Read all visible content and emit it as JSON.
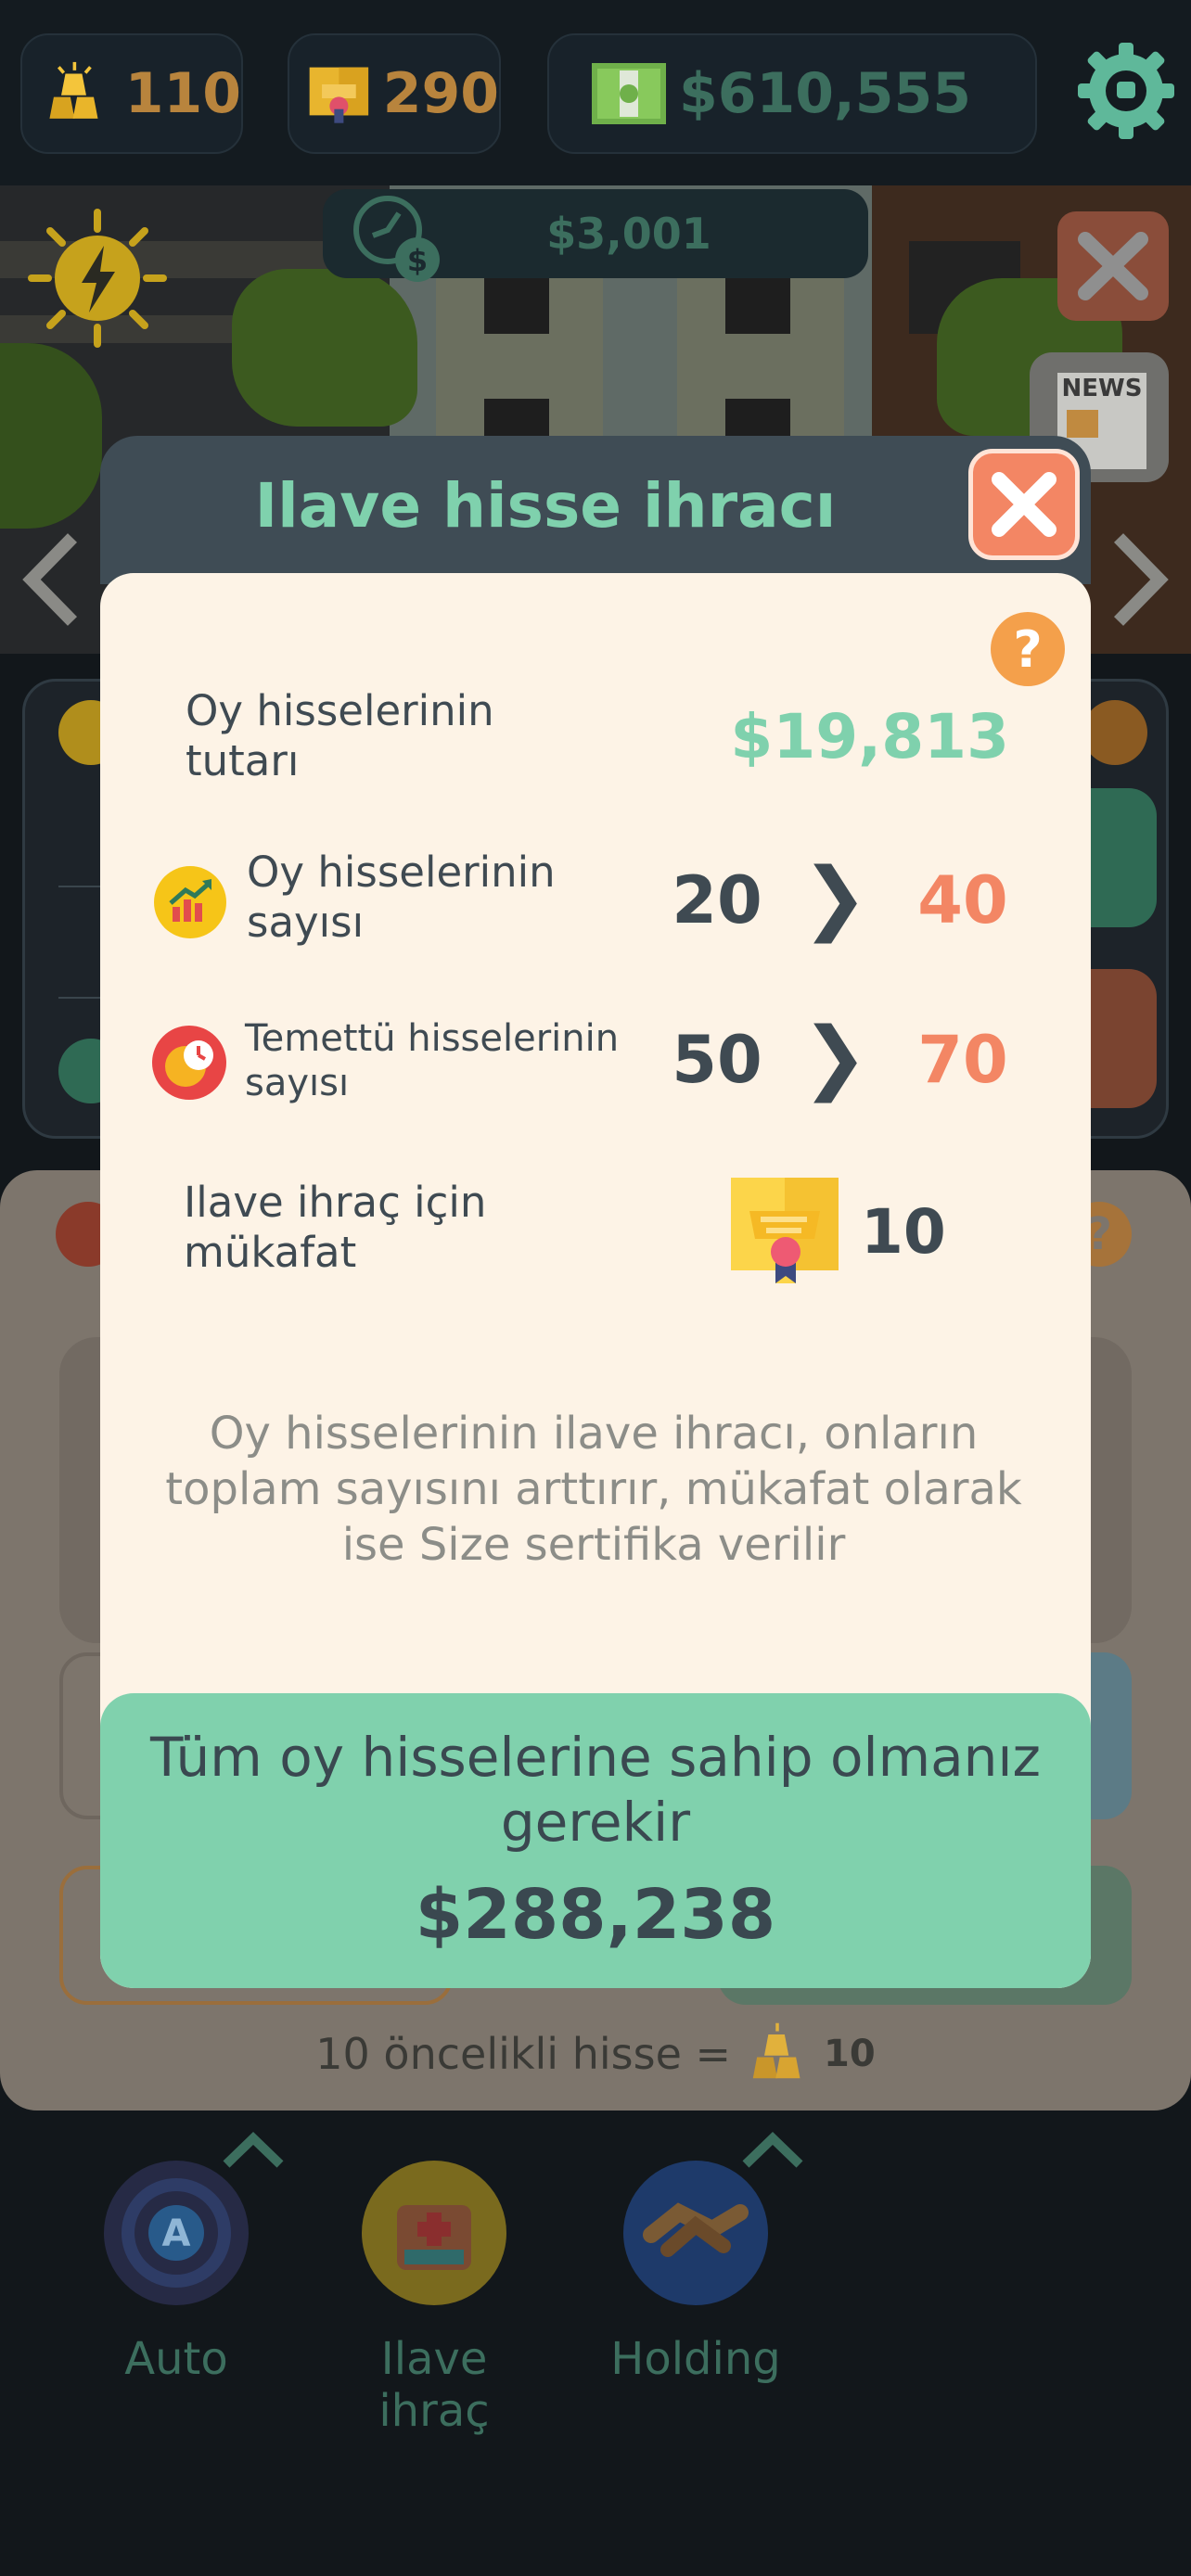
{
  "top_bar": {
    "gold_amount": "110",
    "certificates_amount": "290",
    "cash_amount": "$610,555",
    "settings_icon": "gear-icon"
  },
  "scene": {
    "income_label": "$3,001",
    "news_label": "NEWS"
  },
  "modal": {
    "title": "Ilave hisse ihracı",
    "help_label": "?",
    "rows": {
      "amount_label": "Oy hisselerinin tutarı",
      "amount_value": "$19,813",
      "voting_label": "Oy hisselerinin sayısı",
      "voting_from": "20",
      "voting_to": "40",
      "dividend_label": "Temettü hisselerinin sayısı",
      "dividend_from": "50",
      "dividend_to": "70",
      "reward_label": "Ilave ihraç için mükafat",
      "reward_value": "10",
      "arrow": "❯"
    },
    "description": "Oy hisselerinin ilave ihracı, onların toplam sayısını arttırır, mükafat olarak ise Size sertifika verilir",
    "buy_button": {
      "message": "Tüm oy hisselerine sahip olmanız gerekir",
      "price": "$288,238"
    }
  },
  "background_card": {
    "help_label": "?",
    "priority_text": "10 öncelikli hisse =",
    "priority_value": "10"
  },
  "bottom_nav": {
    "items": [
      {
        "label": "Auto",
        "icon": "steering-wheel-icon"
      },
      {
        "label": "Ilave ihraç",
        "icon": "first-aid-kit-icon"
      },
      {
        "label": "Holding",
        "icon": "handshake-icon"
      }
    ]
  },
  "colors": {
    "accent_green": "#7fd1ad",
    "accent_orange": "#f38664",
    "text_dark": "#3f4a52",
    "modal_bg": "#fdf3e6"
  }
}
